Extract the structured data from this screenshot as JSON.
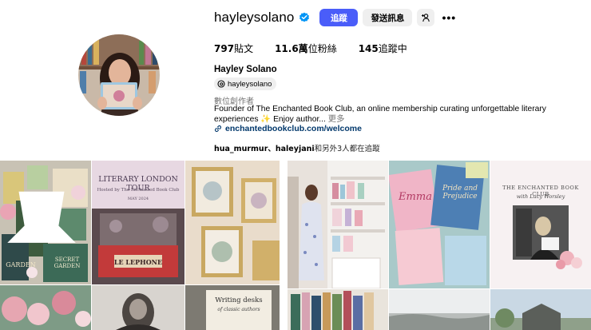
{
  "profile": {
    "username": "hayleysolano",
    "follow_label": "追蹤",
    "message_label": "發送訊息",
    "posts_count": "797",
    "posts_label": "貼文",
    "followers_count": "11.6萬",
    "followers_label": "位粉絲",
    "following_count": "145",
    "following_label": "追蹤中",
    "full_name": "Hayley Solano",
    "threads_handle": "hayleysolano",
    "category": "數位創作者",
    "bio_line1": "Founder of The Enchanted Book Club, an online membership curating unforgettable literary",
    "bio_line2": "experiences ✨ Enjoy author...",
    "bio_more": " 更多",
    "link": "enchantedbookclub.com/welcome",
    "followed_by_names": "hua_murmur、haleyjani",
    "followed_by_rest": "和另外3人都在追蹤"
  },
  "icons": {
    "verified": "verified-badge-icon",
    "add_person": "add-person-icon",
    "more": "more-options-icon",
    "threads": "threads-icon",
    "link": "link-icon",
    "pin": "pinned-post-icon"
  },
  "colors": {
    "accent": "#4a5df9",
    "link": "#00376b",
    "secondary_button": "#efefef",
    "muted_text": "#737373"
  },
  "posts": {
    "tile2_title": "LITERARY LONDON TOUR",
    "tile2_subtitle": "Hosted by The Enchanted Book Club",
    "tile2_date": "MAY 2024",
    "tile2_sign": "LE LEPHONE",
    "tile6_title": "THE ENCHANTED BOOK CLUB",
    "tile6_sub": "with Lucy Worsley",
    "tile9_title": "Writing desks",
    "tile9_sub": "of classic authors",
    "book_title_emma": "Emma",
    "book_title_pride": "Pride and Prejudice",
    "book_title_garden": "GARDEN",
    "book_title_secret": "SECRET GARDEN"
  }
}
